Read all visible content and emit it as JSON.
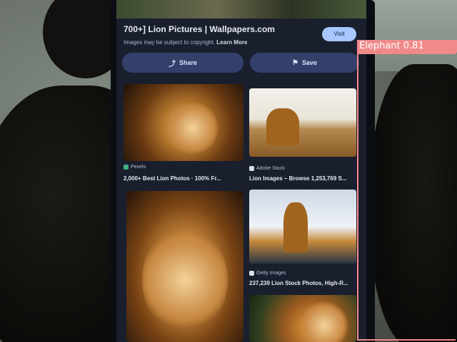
{
  "search_result": {
    "title": "700+] Lion Pictures | Wallpapers.com",
    "subtitle": "Images may be subject to copyright.",
    "learn_more": "Learn More",
    "visit_label": "Visit"
  },
  "actions": {
    "share_label": "Share",
    "save_label": "Save"
  },
  "results": [
    {
      "source": "Pexels",
      "caption": "2,000+ Best Lion Photos · 100% Fr..."
    },
    {
      "source": "Adobe Stock",
      "caption": "Lion Images – Browse 1,253,769 S..."
    },
    {
      "source": "Getty Images",
      "caption": "237,239 Lion Stock Photos, High-R..."
    }
  ],
  "detection": {
    "label": "Elephant 0.81",
    "color": "#f08a8a"
  },
  "icons": {
    "share": "share-icon",
    "save": "bookmark-icon"
  }
}
